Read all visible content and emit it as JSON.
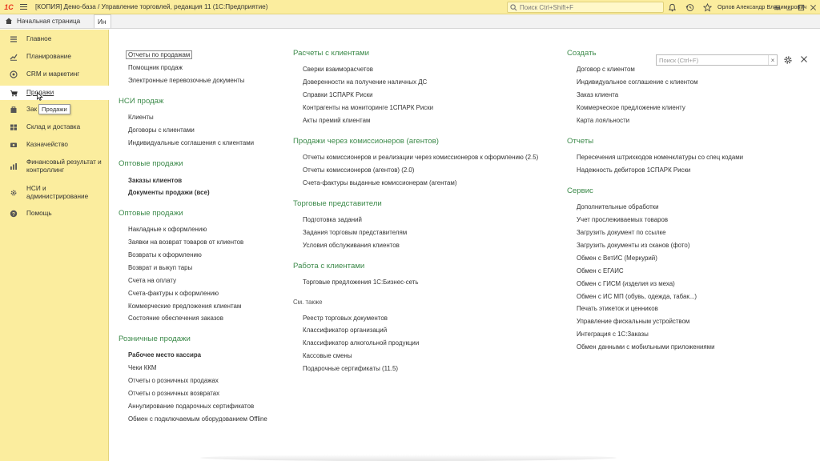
{
  "app": {
    "logo_text": "1С",
    "title": "[КОПИЯ] Демо-база / Управление торговлей, редакция 11  (1С:Предприятие)",
    "search_placeholder": "Поиск Ctrl+Shift+F",
    "user": "Орлов Александр Владимирович"
  },
  "tabs": [
    {
      "label": "Начальная страница"
    },
    {
      "label": "Ин"
    }
  ],
  "sidebar": {
    "items": [
      {
        "label": "Главное",
        "icon": "list-icon"
      },
      {
        "label": "Планирование",
        "icon": "chart-icon"
      },
      {
        "label": "CRM и маркетинг",
        "icon": "crm-icon"
      },
      {
        "label": "Продажи",
        "icon": "cart-icon"
      },
      {
        "label": "Зак",
        "icon": "purchase-icon"
      },
      {
        "label": "Склад и доставка",
        "icon": "warehouse-icon"
      },
      {
        "label": "Казначейство",
        "icon": "treasury-icon"
      },
      {
        "label": "Финансовый результат и контроллинг",
        "icon": "finance-icon"
      },
      {
        "label": "НСИ и администрирование",
        "icon": "settings-icon"
      },
      {
        "label": "Помощь",
        "icon": "help-icon"
      }
    ],
    "tooltip": "Продажи"
  },
  "filter": {
    "placeholder": "Поиск (Ctrl+F)",
    "clear": "×"
  },
  "col1": {
    "top_links": [
      "Отчеты по продажам",
      "Помощник продаж",
      "Электронные перевозочные документы"
    ],
    "nsi": {
      "title": "НСИ продаж",
      "links": [
        "Клиенты",
        "Договоры с клиентами",
        "Индивидуальные соглашения с клиентами"
      ]
    },
    "wholesale1": {
      "title": "Оптовые продажи",
      "links": [
        "Заказы клиентов",
        "Документы продажи (все)"
      ]
    },
    "wholesale2": {
      "title": "Оптовые продажи",
      "links": [
        "Накладные к оформлению",
        "Заявки на возврат товаров от клиентов",
        "Возвраты к оформлению",
        "Возврат и выкуп тары",
        "Счета на оплату",
        "Счета-фактуры к оформлению",
        "Коммерческие предложения клиентам",
        "Состояние обеспечения заказов"
      ]
    },
    "retail": {
      "title": "Розничные продажи",
      "links": [
        "Рабочее место кассира",
        "Чеки ККМ",
        "Отчеты о розничных продажах",
        "Отчеты о розничных возвратах",
        "Аннулирование подарочных сертификатов",
        "Обмен с подключаемым оборудованием Offline"
      ]
    }
  },
  "col2": {
    "settlements": {
      "title": "Расчеты с клиентами",
      "links": [
        "Сверки взаиморасчетов",
        "Доверенности на получение наличных ДС",
        "Справки 1СПАРК Риски",
        "Контрагенты на мониторинге 1СПАРК Риски",
        "Акты премий клиентам"
      ]
    },
    "commission": {
      "title": "Продажи через комиссионеров (агентов)",
      "links": [
        "Отчеты комиссионеров и реализации через комиссионеров к оформлению (2.5)",
        "Отчеты комиссионеров (агентов) (2.0)",
        "Счета-фактуры выданные комиссионерам (агентам)"
      ]
    },
    "reps": {
      "title": "Торговые представители",
      "links": [
        "Подготовка заданий",
        "Задания торговым представителям",
        "Условия обслуживания клиентов"
      ]
    },
    "clients": {
      "title": "Работа с клиентами",
      "links": [
        "Торговые предложения 1С:Бизнес-сеть"
      ]
    },
    "see_also": {
      "title": "См. также",
      "links": [
        "Реестр торговых документов",
        "Классификатор организаций",
        "Классификатор алкогольной продукции",
        "Кассовые смены",
        "Подарочные сертификаты (11.5)"
      ]
    }
  },
  "col3": {
    "create": {
      "title": "Создать",
      "links": [
        "Договор с клиентом",
        "Индивидуальное соглашение с клиентом",
        "Заказ клиента",
        "Коммерческое предложение клиенту",
        "Карта лояльности"
      ]
    },
    "reports": {
      "title": "Отчеты",
      "links": [
        "Пересечения штрихкодов номенклатуры со спец кодами",
        "Надежность дебиторов 1СПАРК Риски"
      ]
    },
    "service": {
      "title": "Сервис",
      "links": [
        "Дополнительные обработки",
        "Учет прослеживаемых товаров",
        "Загрузить документ по ссылке",
        "Загрузить документы из сканов (фото)",
        "Обмен с ВетИС (Меркурий)",
        "Обмен с ЕГАИС",
        "Обмен с ГИСМ (изделия из меха)",
        "Обмен с ИС МП (обувь, одежда, табак...)",
        "Печать этикеток и ценников",
        "Управление фискальным устройством",
        "Интеграция с 1С:Заказы",
        "Обмен данными с мобильными приложениями"
      ]
    }
  },
  "colors": {
    "sidebar_bg": "#fbed9e",
    "heading": "#3c8a4a"
  }
}
